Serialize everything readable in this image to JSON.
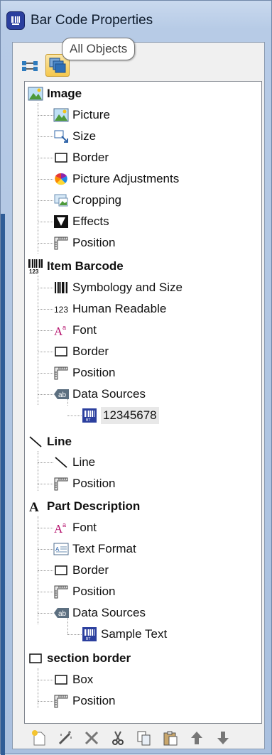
{
  "window": {
    "title": "Bar Code Properties"
  },
  "tooltip": {
    "text": "All Objects"
  },
  "tree": {
    "image": {
      "label": "Image",
      "children": [
        "Picture",
        "Size",
        "Border",
        "Picture Adjustments",
        "Cropping",
        "Effects",
        "Position"
      ]
    },
    "item_barcode": {
      "label": "Item Barcode",
      "children": [
        "Symbology and Size",
        "Human Readable",
        "Font",
        "Border",
        "Position",
        "Data Sources"
      ],
      "data_source_value": "12345678"
    },
    "line": {
      "label": "Line",
      "children": [
        "Line",
        "Position"
      ]
    },
    "part_description": {
      "label": "Part Description",
      "children": [
        "Font",
        "Text Format",
        "Border",
        "Position",
        "Data Sources"
      ],
      "data_source_value": "Sample Text"
    },
    "section_border": {
      "label": "section border",
      "children": [
        "Box",
        "Position"
      ]
    }
  },
  "icons": {
    "app": "barcode-app-icon",
    "toolbar_top": [
      "object-link-icon",
      "all-objects-icon"
    ],
    "toolbar_bottom": [
      "new-icon",
      "magic-wand-icon",
      "delete-icon",
      "cut-icon",
      "copy-icon",
      "paste-icon",
      "move-up-icon",
      "move-down-icon"
    ]
  },
  "colors": {
    "accent": "#2f5d97",
    "selection": "#e8e8e8"
  }
}
